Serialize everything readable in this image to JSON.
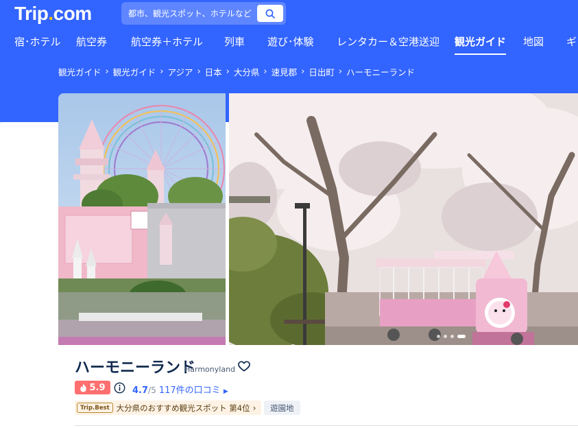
{
  "header": {
    "logo_text": "Trip",
    "logo_dot": ".",
    "logo_suffix": "com",
    "search_placeholder": "都市、観光スポット、ホテルなど"
  },
  "nav": {
    "items": [
      {
        "label": "宿･ホテル"
      },
      {
        "label": "航空券"
      },
      {
        "label": "航空券＋ホテル"
      },
      {
        "label": "列車"
      },
      {
        "label": "遊び･体験"
      },
      {
        "label": "レンタカー＆空港送迎"
      },
      {
        "label": "観光ガイド",
        "active": true
      },
      {
        "label": "地図"
      },
      {
        "label": "ギフ"
      }
    ]
  },
  "breadcrumbs": [
    "観光ガイド",
    "観光ガイド",
    "アジア",
    "日本",
    "大分県",
    "速見郡",
    "日出町",
    "ハーモニーランド"
  ],
  "gallery": {
    "slide_count": 4,
    "active_slide": 4
  },
  "attraction": {
    "name": "ハーモニーランド",
    "name_en": "Harmonyland",
    "heat_score": "5.9",
    "rating": "4.7",
    "rating_max": "/5",
    "reviews": "117件の口コミ",
    "trip_best_logo": "Trip.Best",
    "ranking": "大分県のおすすめ観光スポット 第4位",
    "category": "遊園地"
  },
  "colors": {
    "brand_blue": "#3264ff",
    "heat_red": "#ff6f6f",
    "title_navy": "#0f294d"
  }
}
